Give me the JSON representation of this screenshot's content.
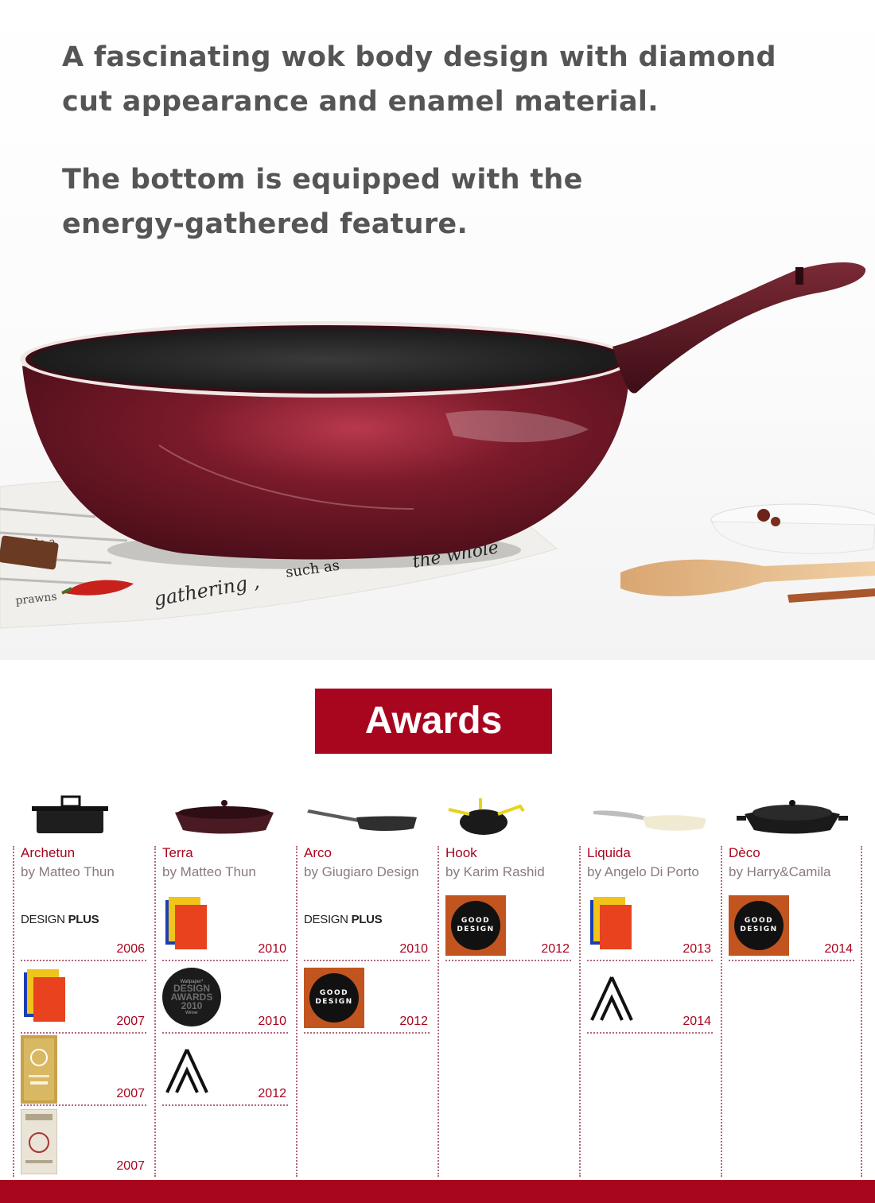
{
  "hero": {
    "headline_1": "A fascinating wok body design with diamond cut appearance and enamel material.",
    "headline_2": "The bottom is equipped with the energy-gathered feature.",
    "newspaper_words": [
      "gathering ,",
      "such as",
      "the whole",
      "prawns",
      "people a"
    ]
  },
  "awards_title": "Awards",
  "award_logos": {
    "design_plus": [
      "DESIGN ",
      "PLUS"
    ],
    "good_design": [
      "GOOD",
      "DESIGN"
    ],
    "wallpaper": [
      "Wallpaper*",
      "DESIGN",
      "AWARDS",
      "2010",
      "Winner"
    ]
  },
  "products": [
    {
      "name": "Archetun",
      "by": "by Matteo Thun",
      "awards": [
        {
          "logo": "design-plus",
          "year": "2006"
        },
        {
          "logo": "design-preis",
          "year": "2007"
        },
        {
          "logo": "gold-medal",
          "year": "2007"
        },
        {
          "logo": "certificate",
          "year": "2007"
        }
      ]
    },
    {
      "name": "Terra",
      "by": "by Matteo Thun",
      "awards": [
        {
          "logo": "design-preis",
          "year": "2010"
        },
        {
          "logo": "wallpaper-design-awards",
          "year": "2010"
        },
        {
          "logo": "a-design",
          "year": "2012"
        }
      ]
    },
    {
      "name": "Arco",
      "by": "by Giugiaro Design",
      "awards": [
        {
          "logo": "design-plus",
          "year": "2010"
        },
        {
          "logo": "good-design",
          "year": "2012"
        }
      ]
    },
    {
      "name": "Hook",
      "by": "by Karim Rashid",
      "awards": [
        {
          "logo": "good-design",
          "year": "2012"
        }
      ]
    },
    {
      "name": "Liquida",
      "by": "by Angelo Di Porto",
      "awards": [
        {
          "logo": "design-preis",
          "year": "2013"
        },
        {
          "logo": "a-design",
          "year": "2014"
        }
      ]
    },
    {
      "name": "Dèco",
      "by": "by Harry&Camila",
      "awards": [
        {
          "logo": "good-design",
          "year": "2014"
        }
      ]
    }
  ],
  "colors": {
    "brand_red": "#a8051f",
    "text_gray": "#555555",
    "wok_burgundy": "#5a1420"
  }
}
